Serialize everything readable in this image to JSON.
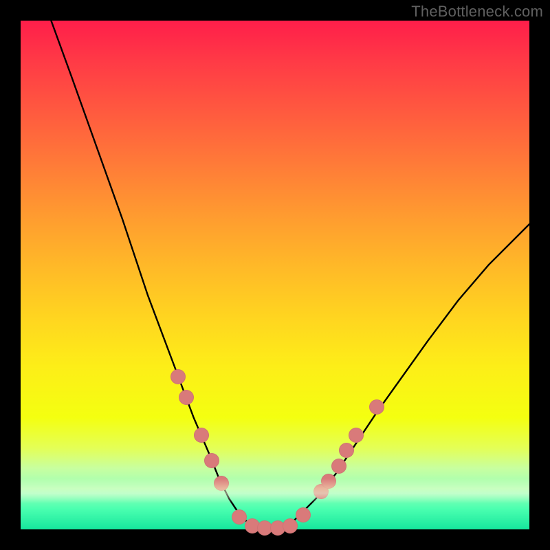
{
  "watermark": "TheBottleneck.com",
  "colors": {
    "frame": "#000000",
    "curve": "#000000",
    "dot": "#d97a7a",
    "gradient_top": "#ff1e4a",
    "gradient_bottom": "#16e69c"
  },
  "chart_data": {
    "type": "line",
    "title": "",
    "xlabel": "",
    "ylabel": "",
    "xlim": [
      0,
      100
    ],
    "ylim": [
      0,
      100
    ],
    "grid": false,
    "legend": false,
    "series": [
      {
        "name": "bottleneck-curve",
        "x": [
          6,
          10,
          15,
          20,
          25,
          28,
          31,
          34,
          37,
          39,
          41,
          43,
          45,
          47,
          49,
          51,
          53,
          55,
          58,
          62,
          66,
          70,
          75,
          80,
          86,
          92,
          100
        ],
        "y": [
          100,
          89,
          75,
          61,
          46,
          38,
          30,
          22,
          15,
          10,
          6,
          3,
          1,
          0,
          0,
          0,
          1,
          3,
          6,
          11,
          17,
          23,
          30,
          37,
          45,
          52,
          60
        ]
      }
    ],
    "markers": [
      {
        "x": 31.0,
        "y": 30.0
      },
      {
        "x": 32.5,
        "y": 26.0
      },
      {
        "x": 35.5,
        "y": 18.5
      },
      {
        "x": 37.5,
        "y": 13.5
      },
      {
        "x": 39.5,
        "y": 9.0
      },
      {
        "x": 43.0,
        "y": 2.5
      },
      {
        "x": 45.5,
        "y": 0.7
      },
      {
        "x": 48.0,
        "y": 0.3
      },
      {
        "x": 50.5,
        "y": 0.3
      },
      {
        "x": 53.0,
        "y": 0.7
      },
      {
        "x": 55.5,
        "y": 2.8
      },
      {
        "x": 59.0,
        "y": 7.5
      },
      {
        "x": 60.5,
        "y": 9.5
      },
      {
        "x": 62.5,
        "y": 12.5
      },
      {
        "x": 64.0,
        "y": 15.5
      },
      {
        "x": 66.0,
        "y": 18.5
      },
      {
        "x": 70.0,
        "y": 24.0
      }
    ]
  }
}
